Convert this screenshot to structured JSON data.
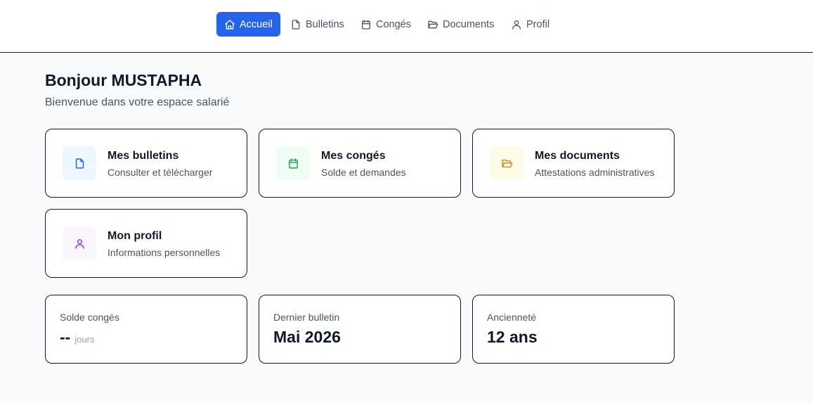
{
  "nav": {
    "items": [
      {
        "label": "Accueil",
        "icon": "home-icon",
        "active": true
      },
      {
        "label": "Bulletins",
        "icon": "file-icon"
      },
      {
        "label": "Congés",
        "icon": "calendar-icon"
      },
      {
        "label": "Documents",
        "icon": "folder-open-icon"
      },
      {
        "label": "Profil",
        "icon": "user-icon"
      }
    ]
  },
  "greeting": {
    "title": "Bonjour MUSTAPHA",
    "subtitle": "Bienvenue dans votre espace salarié"
  },
  "quick_links": [
    {
      "title": "Mes bulletins",
      "desc": "Consulter et télécharger",
      "icon": "file-icon",
      "icon_color": "#2563eb",
      "icon_bg": "#eff6ff"
    },
    {
      "title": "Mes congés",
      "desc": "Solde et demandes",
      "icon": "calendar-icon",
      "icon_color": "#16a34a",
      "icon_bg": "#f0fdf4"
    },
    {
      "title": "Mes documents",
      "desc": "Attestations administratives",
      "icon": "folder-open-icon",
      "icon_color": "#ca8a04",
      "icon_bg": "#fefce8"
    },
    {
      "title": "Mon profil",
      "desc": "Informations personnelles",
      "icon": "user-icon",
      "icon_color": "#9333ea",
      "icon_bg": "#faf5ff"
    }
  ],
  "stats": [
    {
      "label": "Solde congés",
      "value": "--",
      "unit": "jours"
    },
    {
      "label": "Dernier bulletin",
      "value": "Mai 2026"
    },
    {
      "label": "Ancienneté",
      "value": "12 ans"
    }
  ],
  "colors": {
    "accent": "#2563eb"
  }
}
